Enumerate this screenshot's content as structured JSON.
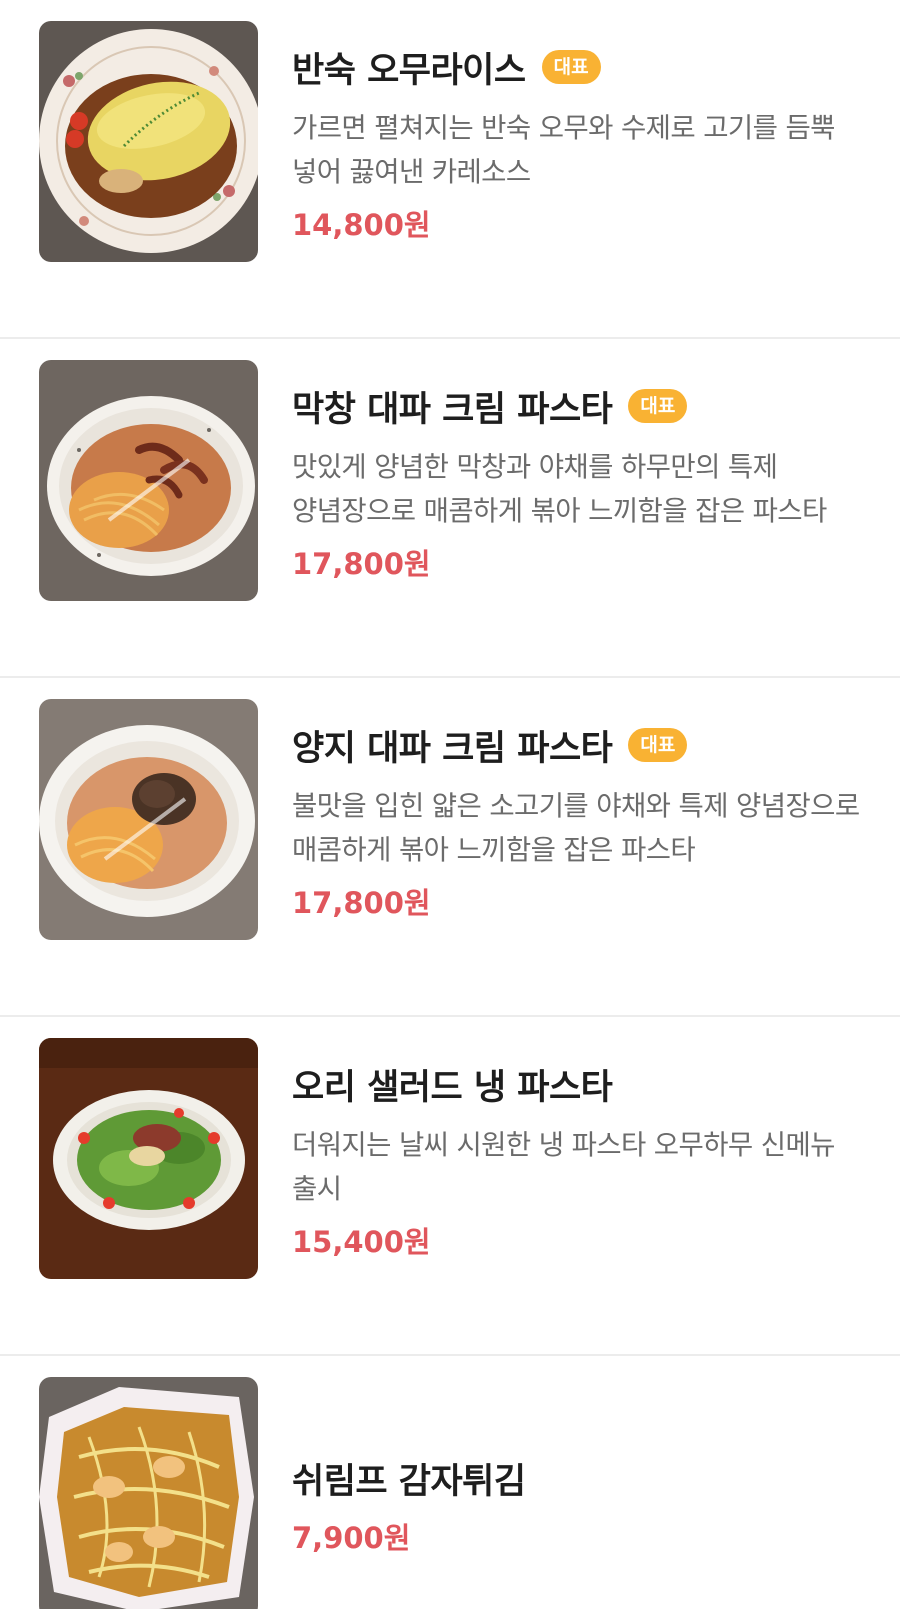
{
  "menu": [
    {
      "name": "반숙 오무라이스",
      "badge": "대표",
      "description": "가르면 펼쳐지는 반숙 오무와 수제로 고기를 듬뿍 넣어 끓여낸 카레소스",
      "price": "14,800원",
      "image_icon": "omurice-photo"
    },
    {
      "name": "막창 대파 크림 파스타",
      "badge": "대표",
      "description": "맛있게 양념한 막창과 야채를 하무만의 특제 양념장으로 매콤하게 볶아 느끼함을 잡은 파스타",
      "price": "17,800원",
      "image_icon": "makchang-pasta-photo"
    },
    {
      "name": "양지 대파 크림 파스타",
      "badge": "대표",
      "description": "불맛을 입힌 얇은 소고기를 야채와 특제 양념장으로 매콤하게 볶아 느끼함을 잡은 파스타",
      "price": "17,800원",
      "image_icon": "brisket-pasta-photo"
    },
    {
      "name": "오리 샐러드 냉 파스타",
      "badge": "",
      "description": "더워지는 날씨 시원한 냉 파스타 오무하무 신메뉴 출시",
      "price": "15,400원",
      "image_icon": "duck-salad-photo"
    },
    {
      "name": "쉬림프 감자튀김",
      "badge": "",
      "description": "",
      "price": "7,900원",
      "image_icon": "shrimp-fries-photo"
    }
  ],
  "colors": {
    "badge": "#f9b233",
    "price": "#e0565c",
    "title": "#1e1e1e",
    "description": "#6b6b6b",
    "divider": "#ececec"
  }
}
